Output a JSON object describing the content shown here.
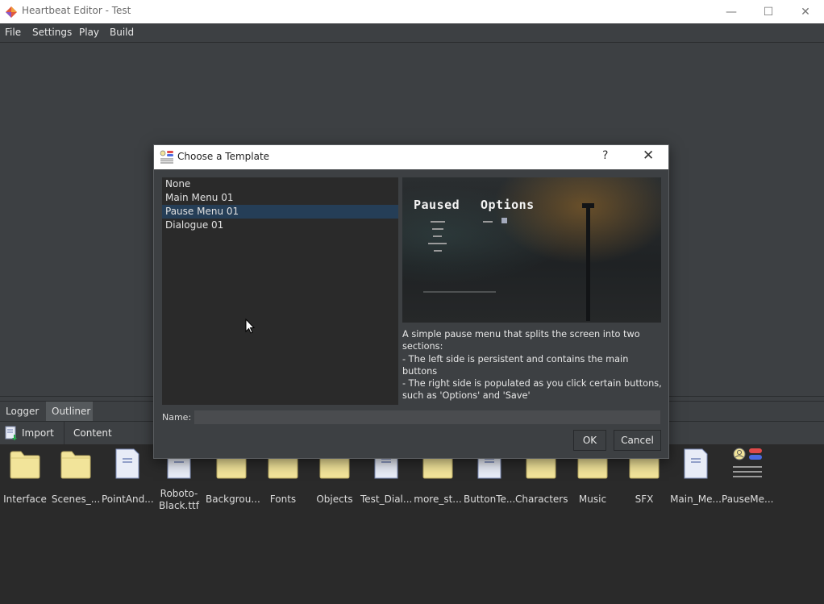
{
  "window": {
    "title": "Heartbeat Editor - Test",
    "minimize_glyph": "—",
    "maximize_glyph": "☐",
    "close_glyph": "✕"
  },
  "menu": {
    "items": [
      "File",
      "Settings",
      "Play",
      "Build"
    ]
  },
  "bottom_panel": {
    "tabs": [
      {
        "label": "Logger",
        "active": false
      },
      {
        "label": "Outliner",
        "active": true
      }
    ],
    "toolbar": {
      "import_label": "Import",
      "content_label": "Content"
    },
    "assets": [
      {
        "label": "Interface",
        "icon": "folder-icon"
      },
      {
        "label": "Scenes_...",
        "icon": "folder-icon"
      },
      {
        "label": "PointAnd...",
        "icon": "document-icon"
      },
      {
        "label": "Roboto-\nBlack.ttf",
        "icon": "font-file-icon"
      },
      {
        "label": "Backgrou...",
        "icon": "folder-icon"
      },
      {
        "label": "Fonts",
        "icon": "folder-icon"
      },
      {
        "label": "Objects",
        "icon": "folder-icon"
      },
      {
        "label": "Test_Dial...",
        "icon": "document-icon"
      },
      {
        "label": "more_st...",
        "icon": "folder-icon"
      },
      {
        "label": "ButtonTe...",
        "icon": "document-icon"
      },
      {
        "label": "Characters",
        "icon": "folder-icon"
      },
      {
        "label": "Music",
        "icon": "folder-icon"
      },
      {
        "label": "SFX",
        "icon": "folder-icon"
      },
      {
        "label": "Main_Me...",
        "icon": "document-icon"
      },
      {
        "label": "PauseMe...",
        "icon": "interface-template-icon"
      }
    ]
  },
  "dialog": {
    "title": "Choose a Template",
    "help_glyph": "?",
    "close_glyph": "✕",
    "templates": [
      {
        "label": "None",
        "selected": false
      },
      {
        "label": "Main Menu 01",
        "selected": false
      },
      {
        "label": "Pause Menu 01",
        "selected": true
      },
      {
        "label": "Dialogue 01",
        "selected": false
      }
    ],
    "preview": {
      "left_title": "Paused",
      "right_title": "Options"
    },
    "description": "A simple pause menu that splits the screen into two sections:\n- The left side is persistent and contains the main buttons\n- The right side is populated as you click certain buttons, such as 'Options' and 'Save'",
    "name_label": "Name:",
    "name_value": "",
    "ok_label": "OK",
    "cancel_label": "Cancel"
  },
  "colors": {
    "selection": "#253e57",
    "folder": "#f2e49a",
    "background": "#3d4043",
    "panel": "#2a2a2a"
  }
}
